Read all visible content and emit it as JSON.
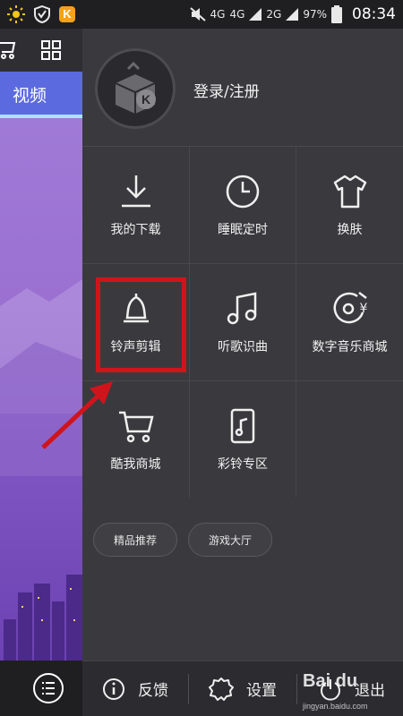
{
  "status_bar": {
    "network_1": "4G",
    "network_2": "4G",
    "network_3": "2G",
    "battery": "97%",
    "time": "08:34"
  },
  "background_app": {
    "tab_label": "视频"
  },
  "drawer": {
    "login_label": "登录/注册",
    "grid": [
      {
        "label": "我的下载",
        "icon": "download-icon"
      },
      {
        "label": "睡眠定时",
        "icon": "clock-icon"
      },
      {
        "label": "换肤",
        "icon": "shirt-icon"
      },
      {
        "label": "铃声剪辑",
        "icon": "bell-icon"
      },
      {
        "label": "听歌识曲",
        "icon": "music-note-icon"
      },
      {
        "label": "数字音乐商城",
        "icon": "music-store-icon"
      },
      {
        "label": "酷我商城",
        "icon": "cart-icon"
      },
      {
        "label": "彩铃专区",
        "icon": "phone-music-icon"
      }
    ],
    "chips": [
      "精品推荐",
      "游戏大厅"
    ],
    "footer": {
      "feedback": "反馈",
      "settings": "设置",
      "exit": "退出"
    }
  },
  "watermark": {
    "brand": "Bai du",
    "url": "jingyan.baidu.com"
  },
  "colors": {
    "highlight": "#d0141c",
    "drawer_bg": "#3a3a3e",
    "tab_bg": "#5c6ae0"
  }
}
